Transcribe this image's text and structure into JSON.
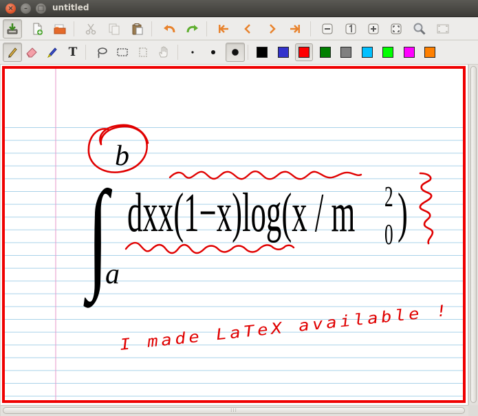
{
  "window": {
    "title": "untitled",
    "close_glyph": "×",
    "minimize_glyph": "–",
    "maximize_glyph": "□"
  },
  "toolbar_main": {
    "buttons": [
      {
        "name": "save-button",
        "icon": "save-icon"
      },
      {
        "name": "new-page-button",
        "icon": "new-page-icon"
      },
      {
        "name": "open-button",
        "icon": "folder-icon"
      },
      {
        "name": "cut-button",
        "icon": "scissors-icon"
      },
      {
        "name": "copy-button",
        "icon": "copy-icon"
      },
      {
        "name": "paste-button",
        "icon": "clipboard-icon"
      },
      {
        "name": "undo-button",
        "icon": "undo-icon"
      },
      {
        "name": "redo-button",
        "icon": "redo-icon"
      },
      {
        "name": "first-page-button",
        "icon": "first-page-icon"
      },
      {
        "name": "previous-page-button",
        "icon": "chevron-left-icon"
      },
      {
        "name": "next-page-button",
        "icon": "chevron-right-icon"
      },
      {
        "name": "last-page-button",
        "icon": "last-page-icon"
      },
      {
        "name": "zoom-out-button",
        "icon": "zoom-out-icon"
      },
      {
        "name": "zoom-100-button",
        "icon": "zoom-100-icon"
      },
      {
        "name": "zoom-in-button",
        "icon": "zoom-in-icon"
      },
      {
        "name": "zoom-fit-button",
        "icon": "zoom-fit-icon"
      },
      {
        "name": "zoom-search-button",
        "icon": "magnifier-icon"
      },
      {
        "name": "fullscreen-button",
        "icon": "fullscreen-icon"
      }
    ]
  },
  "toolbar_tools": {
    "tools": [
      {
        "name": "pen-tool",
        "icon": "pencil-icon",
        "active": true
      },
      {
        "name": "eraser-tool",
        "icon": "eraser-icon",
        "active": false
      },
      {
        "name": "highlighter-tool",
        "icon": "highlighter-icon",
        "active": false
      },
      {
        "name": "text-tool",
        "icon": "text-icon",
        "label": "T",
        "active": false
      },
      {
        "name": "lasso-tool",
        "icon": "lasso-icon",
        "active": false
      },
      {
        "name": "rect-select-tool",
        "icon": "rect-select-icon",
        "active": false
      },
      {
        "name": "vertical-space-tool",
        "icon": "vertical-space-icon",
        "active": false
      },
      {
        "name": "hand-tool",
        "icon": "hand-icon",
        "active": false
      }
    ],
    "thickness": [
      "fine",
      "medium",
      "thick"
    ],
    "thickness_selected": "thick",
    "colors": [
      "#000000",
      "#3333cc",
      "#ff0000",
      "#008000",
      "#808080",
      "#00c0ff",
      "#00ff00",
      "#ff00ff",
      "#ff8000"
    ],
    "color_selected": "#ff0000"
  },
  "page": {
    "ruling": "lined",
    "line_color": "#a9d2e9",
    "margin_color": "#e796c9",
    "formula_color": "#000000",
    "ink_color": "#e00000",
    "formula": {
      "integral": "∫",
      "upper_limit": "b",
      "lower_limit": "a",
      "body_part1": "dxx(1−x)log(x / m",
      "subscript": "0",
      "superscript": "2",
      "body_end": ")"
    },
    "handwritten_text": "I made LaTeX available !"
  }
}
